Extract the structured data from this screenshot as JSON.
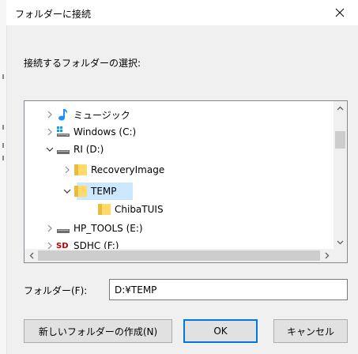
{
  "window": {
    "title": "フォルダーに接続",
    "close_icon": "close-icon"
  },
  "instruction": "接続するフォルダーの選択:",
  "tree": {
    "items": [
      {
        "label": "ミュージック",
        "icon": "music-note-icon",
        "expander": "chevron-right"
      },
      {
        "label": "Windows (C:)",
        "icon": "windows-drive-icon",
        "expander": "chevron-right"
      },
      {
        "label": "RI (D:)",
        "icon": "drive-icon",
        "expander": "chevron-down"
      },
      {
        "label": "RecoveryImage",
        "icon": "folder-icon",
        "expander": "chevron-right"
      },
      {
        "label": "TEMP",
        "icon": "folder-icon",
        "expander": "chevron-down",
        "selected": true
      },
      {
        "label": "ChibaTUIS",
        "icon": "folder-icon",
        "expander": "none"
      },
      {
        "label": "HP_TOOLS (E:)",
        "icon": "drive-icon",
        "expander": "chevron-right"
      },
      {
        "label": "SDHC (F:)",
        "icon": "sd-card-icon",
        "expander": "chevron-right"
      }
    ]
  },
  "folder_field": {
    "label": "フォルダー(F):",
    "value": "D:¥TEMP"
  },
  "buttons": {
    "new_folder": "新しいフォルダーの作成(N)",
    "ok": "OK",
    "cancel": "キャンセル"
  },
  "colors": {
    "selection": "#cce8ff",
    "default_button_border": "#0078d7",
    "folder_yellow": "#ffd969",
    "music_blue": "#1e90ff"
  }
}
